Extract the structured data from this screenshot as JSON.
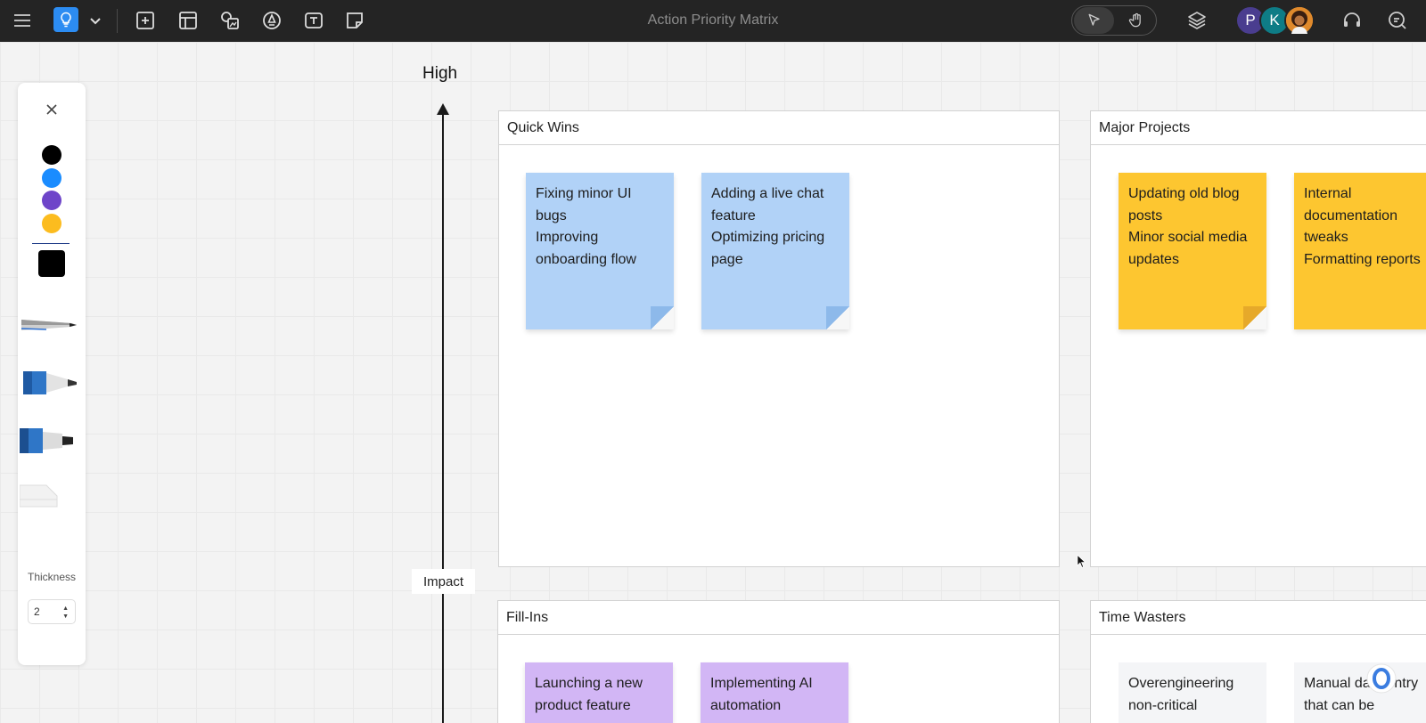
{
  "app": {
    "title": "Action Priority Matrix",
    "accent_color": "#2c8cf2"
  },
  "toolbar": {
    "left_icons": [
      "menu-icon",
      "lightbulb-icon",
      "chevron-down-icon",
      "add-frame-icon",
      "template-icon",
      "image-shapes-icon",
      "pen-icon",
      "text-icon",
      "sticky-note-icon"
    ],
    "right_icons": [
      "select-cursor-icon",
      "hand-pan-icon",
      "layers-icon",
      "headset-icon",
      "comment-search-icon"
    ],
    "mode_active": "select"
  },
  "collaborators": [
    {
      "initial": "P",
      "color": "#4a3d8f"
    },
    {
      "initial": "K",
      "color": "#0e7c86"
    },
    {
      "initial": "",
      "color": "#e08a2c"
    }
  ],
  "draw_panel": {
    "colors": [
      "#000000",
      "#1a8cff",
      "#6e45c9",
      "#fcbc1f"
    ],
    "selected_color": "#000000",
    "tools": [
      "fine-pen",
      "blue-marker",
      "blue-highlighter",
      "eraser"
    ],
    "thickness_label": "Thickness",
    "thickness_value": "2"
  },
  "axis": {
    "top_label": "High",
    "name": "Impact"
  },
  "quadrants": [
    {
      "title": "Quick Wins",
      "notes": [
        {
          "color": "blue",
          "lines": [
            "Fixing minor UI",
            "bugs",
            "Improving",
            "onboarding flow"
          ]
        },
        {
          "color": "blue",
          "lines": [
            "Adding a live chat",
            "feature",
            "Optimizing pricing",
            "page"
          ]
        }
      ]
    },
    {
      "title": "Major Projects",
      "notes": [
        {
          "color": "yellow",
          "lines": [
            "Updating old blog",
            "posts",
            "Minor social media",
            "updates"
          ]
        },
        {
          "color": "yellow",
          "lines": [
            "Internal",
            "documentation",
            "tweaks",
            "Formatting reports"
          ]
        }
      ]
    },
    {
      "title": "Fill-Ins",
      "notes": [
        {
          "color": "purple",
          "lines": [
            "Launching a new",
            "product feature"
          ]
        },
        {
          "color": "purple",
          "lines": [
            "Implementing AI",
            "automation"
          ]
        }
      ]
    },
    {
      "title": "Time Wasters",
      "notes": [
        {
          "color": "grey",
          "lines": [
            "Overengineering",
            "non-critical"
          ]
        },
        {
          "color": "grey",
          "lines": [
            "Manual data entry",
            "that can be"
          ]
        }
      ]
    }
  ]
}
